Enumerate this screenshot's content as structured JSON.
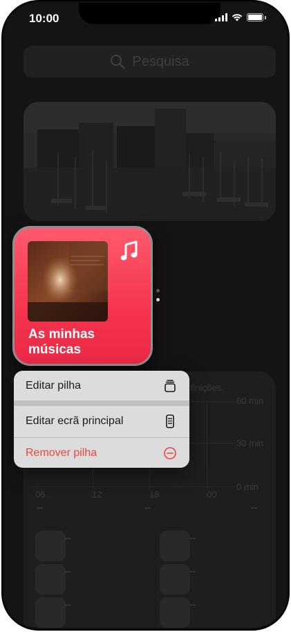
{
  "status_bar": {
    "time": "10:00"
  },
  "search": {
    "placeholder": "Pesquisa"
  },
  "widget": {
    "title": "As minhas músicas"
  },
  "context_menu": {
    "items": [
      {
        "label": "Editar pilha",
        "icon": "stack-icon"
      },
      {
        "label": "Editar ecrã principal",
        "icon": "phone-icon"
      },
      {
        "label": "Remover pilha",
        "icon": "minus-circle-icon",
        "destructive": true
      }
    ]
  },
  "background_widget": {
    "caption": "finições.",
    "y_ticks": [
      "60 min",
      "30 min",
      "0 min"
    ],
    "x_ticks": [
      "06",
      "12",
      "18",
      "00"
    ],
    "placeholder": "--"
  },
  "colors": {
    "accent": "#f5354f",
    "destructive": "#e8473f"
  }
}
